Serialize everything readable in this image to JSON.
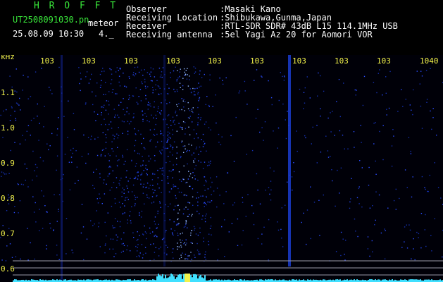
{
  "header": {
    "logo": "H R O F F T",
    "filename": "UT2508091030.pn",
    "mode": "meteor",
    "datetime": "25.08.09 10:30",
    "sub": "4._",
    "info": [
      {
        "label": "Observer",
        "value": ":Masaki Kano"
      },
      {
        "label": "Receiving Location",
        "value": ":Shibukawa,Gunma,Japan"
      },
      {
        "label": "Receiver",
        "value": ":RTL-SDR SDR# 43dB L15 114.1MHz USB"
      },
      {
        "label": "Receiving antenna",
        "value": ":5el Yagi Az 20 for Aomori VOR"
      }
    ]
  },
  "spectrogram": {
    "unit_label": "kHz",
    "time_labels": [
      "103",
      "103",
      "103",
      "103",
      "103",
      "103",
      "103",
      "103",
      "103",
      "1040"
    ],
    "freq_labels": [
      "1.1",
      "1.0",
      "0.9",
      "0.8",
      "0.7",
      "0.6"
    ],
    "colors": {
      "text_green": "#39e83a",
      "text_yellow": "#f2f24a",
      "noise_blue": "#1432c8",
      "signal_cyan": "#40e0ff"
    }
  }
}
